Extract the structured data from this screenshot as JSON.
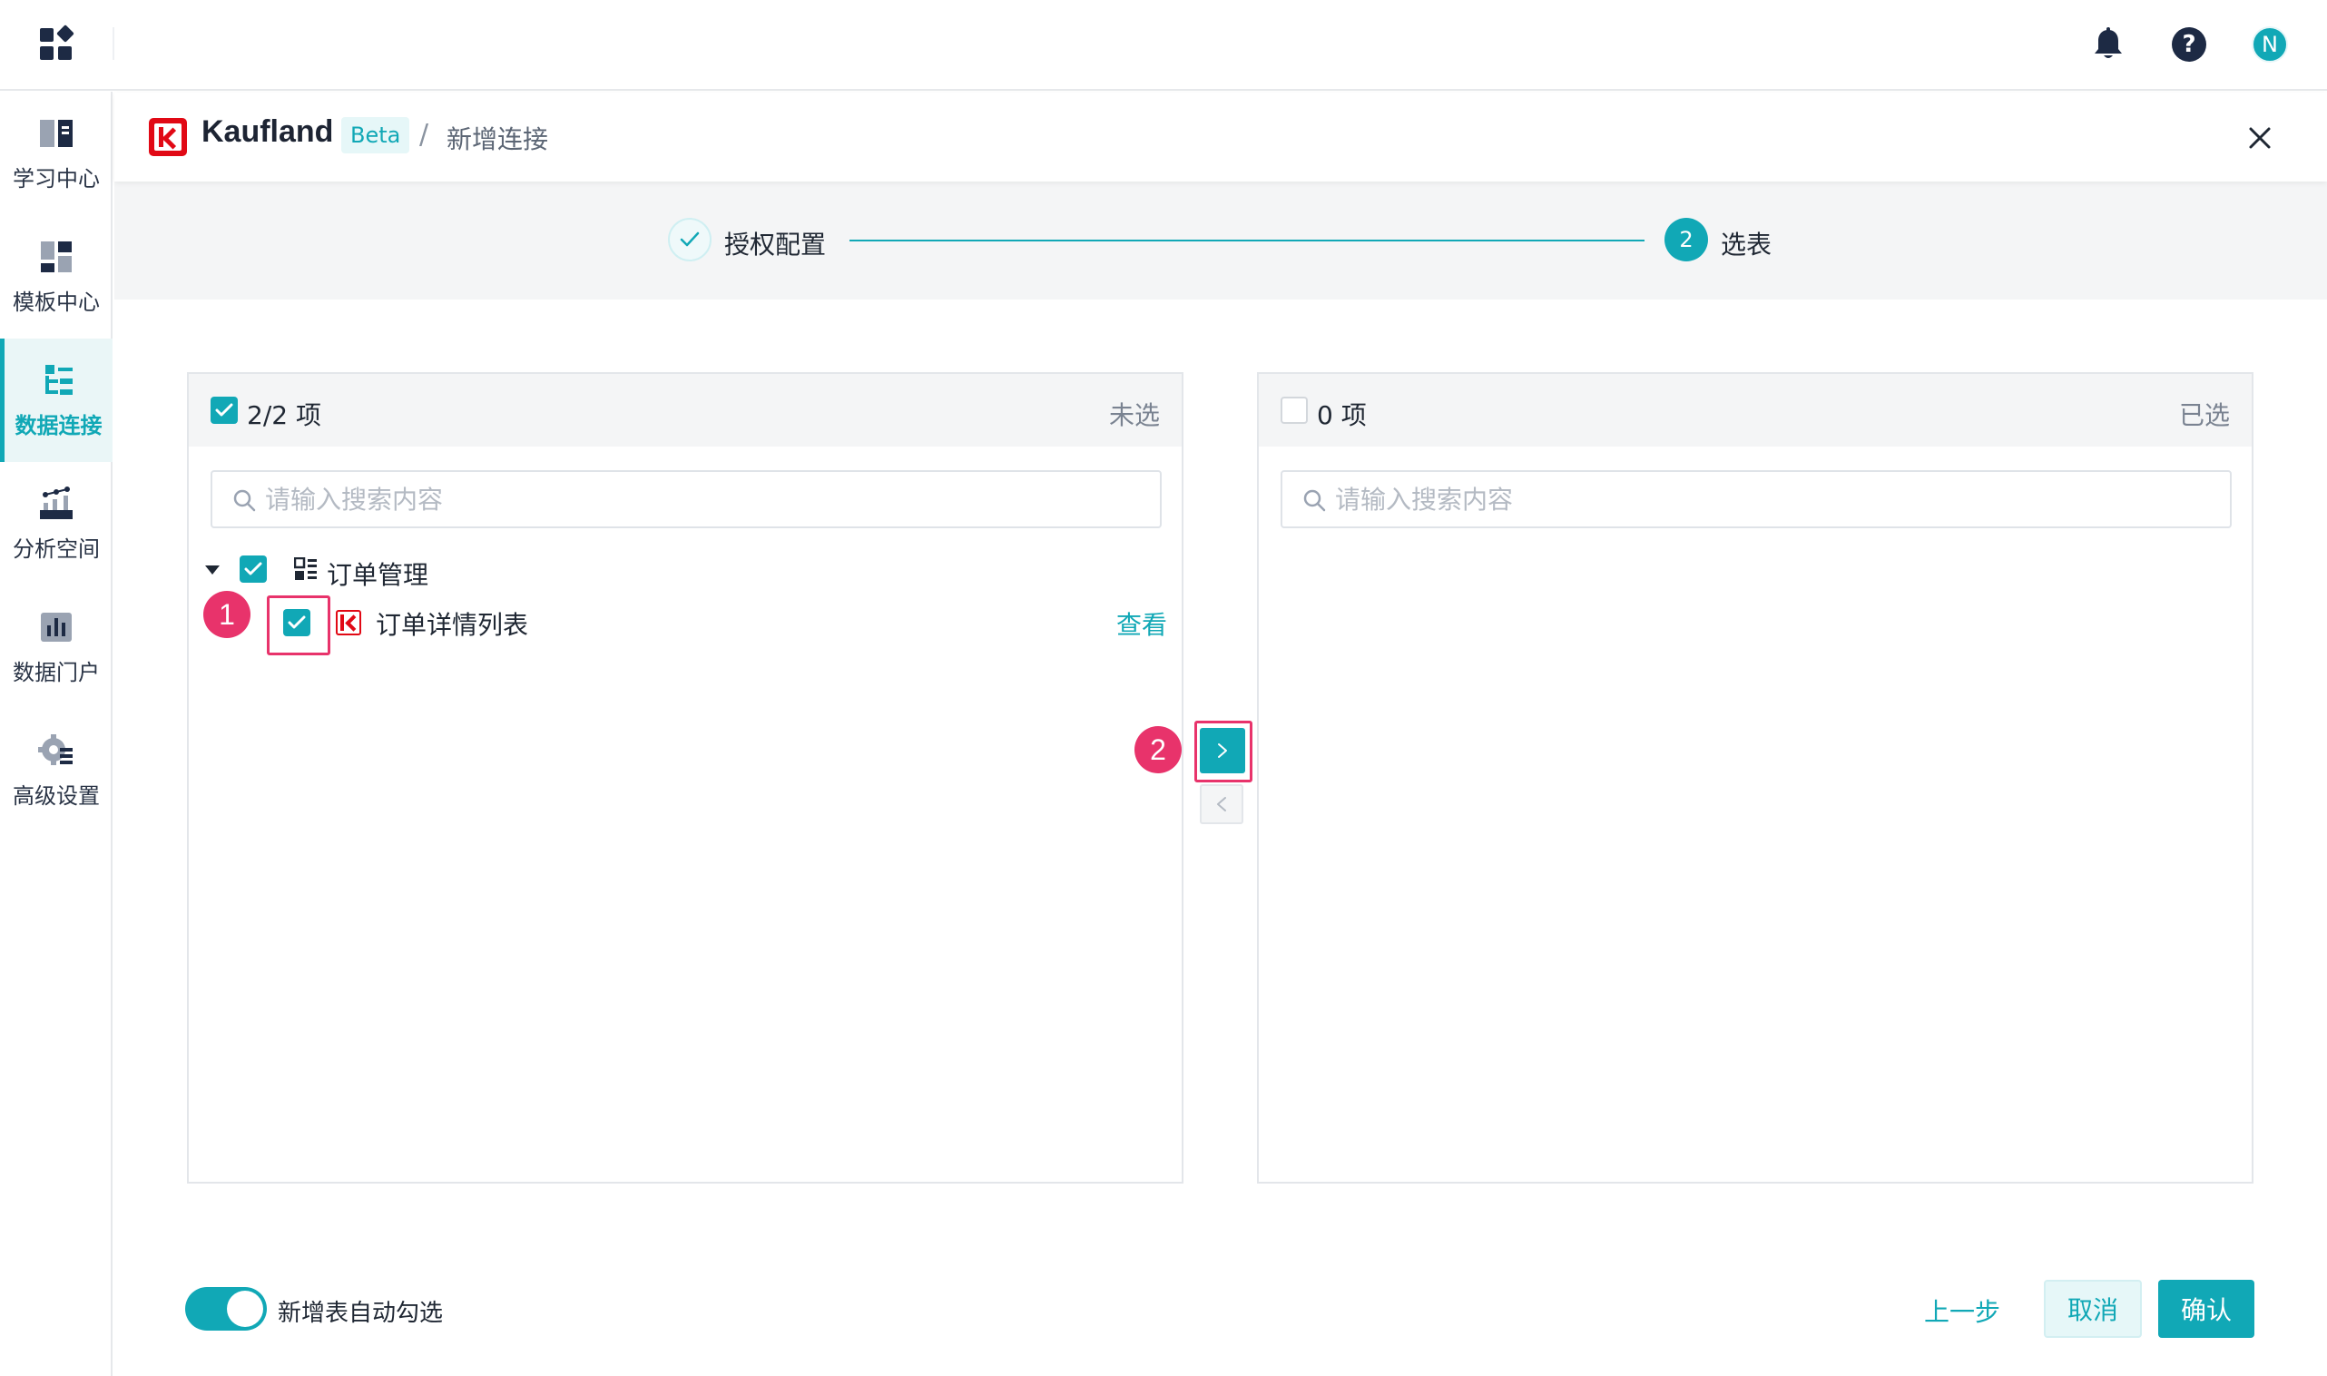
{
  "colors": {
    "accent": "#11a8b6",
    "brand_red": "#e10915",
    "marker_pink": "#e8336b",
    "nav_dark": "#1d2a44"
  },
  "topbar": {
    "avatar_letter": "N",
    "icons": [
      "apps-grid-icon",
      "bell-icon",
      "help-icon"
    ]
  },
  "sidebar": {
    "items": [
      {
        "label": "学习中心",
        "icon": "book-icon",
        "active": false
      },
      {
        "label": "模板中心",
        "icon": "template-icon",
        "active": false
      },
      {
        "label": "数据连接",
        "icon": "data-connection-icon",
        "active": true
      },
      {
        "label": "分析空间",
        "icon": "analysis-icon",
        "active": false
      },
      {
        "label": "数据门户",
        "icon": "bar-chart-icon",
        "active": false
      },
      {
        "label": "高级设置",
        "icon": "settings-gear-icon",
        "active": false
      }
    ]
  },
  "header": {
    "brand": "Kaufland",
    "badge": "Beta",
    "separator": "/",
    "current": "新增连接"
  },
  "steps": [
    {
      "label": "授权配置",
      "status": "done"
    },
    {
      "number": "2",
      "label": "选表",
      "status": "active"
    }
  ],
  "left_panel": {
    "count": "2/2 项",
    "title": "未选",
    "search_placeholder": "请输入搜索内容",
    "group": {
      "label": "订单管理",
      "checked": true,
      "expanded": true
    },
    "items": [
      {
        "label": "订单详情列表",
        "checked": true,
        "action": "查看"
      }
    ]
  },
  "right_panel": {
    "count": "0 项",
    "title": "已选",
    "search_placeholder": "请输入搜索内容",
    "items": []
  },
  "markers": {
    "first": "1",
    "second": "2"
  },
  "footer": {
    "toggle_label": "新增表自动勾选",
    "toggle_on": true,
    "prev": "上一步",
    "cancel": "取消",
    "confirm": "确认"
  }
}
